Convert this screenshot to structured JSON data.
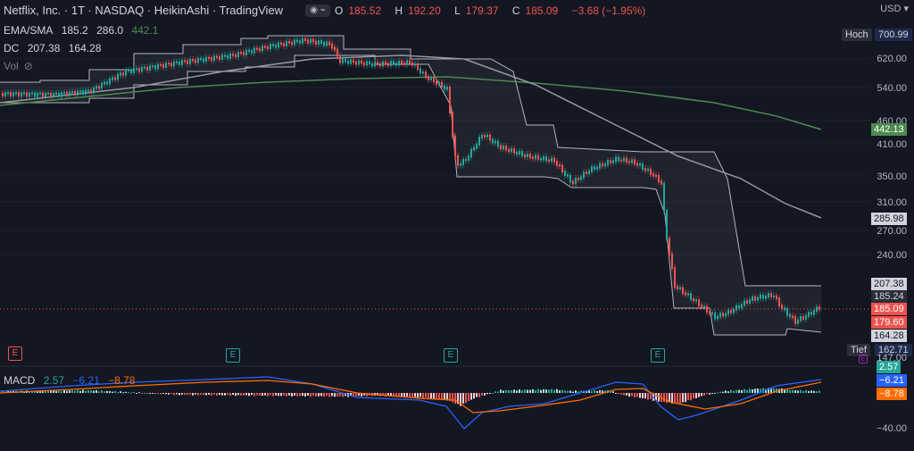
{
  "header": {
    "symbol_line": "Netflix, Inc. · 1T · NASDAQ · HeikinAshi · TradingView",
    "ohlc": {
      "o_label": "O",
      "o": "185.52",
      "h_label": "H",
      "h": "192.20",
      "l_label": "L",
      "l": "179.37",
      "c_label": "C",
      "c": "185.09",
      "change": "−3.68 (−1.95%)"
    },
    "ema_label": "EMA/SMA",
    "ema_v1": "185.2",
    "ema_v2": "286.0",
    "ema_v3": "442.1",
    "dc_label": "DC",
    "dc_v1": "207.38",
    "dc_v2": "164.28",
    "vol_label": "Vol"
  },
  "price_axis": {
    "currency": "USD",
    "ticks": [
      "620.00",
      "540.00",
      "460.00",
      "410.00",
      "350.00",
      "310.00",
      "270.00",
      "240.00",
      "147.00"
    ],
    "hoch_label": "Hoch",
    "hoch_value": "700.99",
    "tief_label": "Tief",
    "tief_value": "162.71",
    "tags": {
      "sma_slow": "442.13",
      "sma_mid": "285.98",
      "dc_upper": "207.38",
      "ema_fast": "185.24",
      "close": "185.09",
      "low": "179.60",
      "dc_lower": "164.28"
    }
  },
  "macd": {
    "label": "MACD",
    "v1": "2.57",
    "v2": "−6.21",
    "v3": "−8.78",
    "axis_tick": "−40.00",
    "tags": {
      "hist": "2.57",
      "macd": "−6.21",
      "signal": "−8.78"
    }
  },
  "earnings_marker": "E",
  "colors": {
    "bg": "#131722",
    "up": "#26a69a",
    "down": "#ef5350",
    "sma_slow": "#4c8a4f",
    "band": "#b2b5be",
    "macd_line": "#2962ff",
    "signal_line": "#ff6d00"
  },
  "chart_data": {
    "type": "candlestick",
    "description_series": "HeikinAshi daily candles",
    "price_range": [
      140,
      700
    ],
    "key_levels": {
      "close": 185.09,
      "high": 700.99,
      "low": 162.71
    }
  }
}
